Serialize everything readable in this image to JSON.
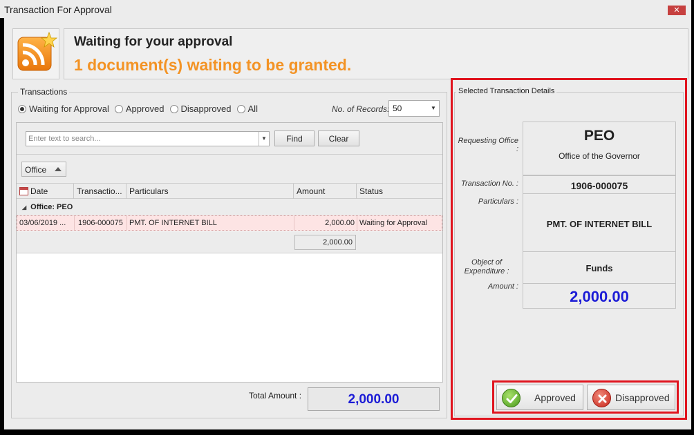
{
  "window": {
    "title": "Transaction For Approval",
    "close_glyph": "✕"
  },
  "header": {
    "icon": "rss-feed-star-icon",
    "title": "Waiting for your approval",
    "subtitle": "1 document(s)  waiting to be granted."
  },
  "transactions": {
    "group_label": "Transactions",
    "filters": [
      {
        "label": "Waiting for Approval",
        "checked": true
      },
      {
        "label": "Approved",
        "checked": false
      },
      {
        "label": "Disapproved",
        "checked": false
      },
      {
        "label": "All",
        "checked": false
      }
    ],
    "records_label": "No. of Records:",
    "records_value": "50",
    "search_placeholder": "Enter text to search...",
    "find_label": "Find",
    "clear_label": "Clear",
    "group_by_label": "Office",
    "columns": [
      "Date",
      "Transactio...",
      "Particulars",
      "Amount",
      "Status"
    ],
    "group_row": "Office: PEO",
    "rows": [
      {
        "date": "03/06/2019 ...",
        "transaction": "1906-000075",
        "particulars": "PMT. OF  INTERNET BILL",
        "amount": "2,000.00",
        "status": "Waiting for Approval"
      }
    ],
    "group_sum": "2,000.00",
    "total_label": "Total Amount :",
    "total_value": "2,000.00"
  },
  "details": {
    "group_label": "Selected Transaction Details",
    "requesting_office_label": "Requesting Office :",
    "office_code": "PEO",
    "office_name": "Office of the Governor",
    "transaction_no_label": "Transaction No. :",
    "transaction_no": "1906-000075",
    "particulars_label": "Particulars :",
    "particulars": "PMT. OF  INTERNET BILL",
    "object_label_1": "Object of",
    "object_label_2": "Expenditure :",
    "object_value": "Funds",
    "amount_label": "Amount :",
    "amount_value": "2,000.00"
  },
  "actions": {
    "approve_label": "Approved",
    "disapprove_label": "Disapproved"
  },
  "colors": {
    "accent_orange": "#f39325",
    "amount_blue": "#1c1cd6",
    "highlight_red": "#e0141e"
  }
}
